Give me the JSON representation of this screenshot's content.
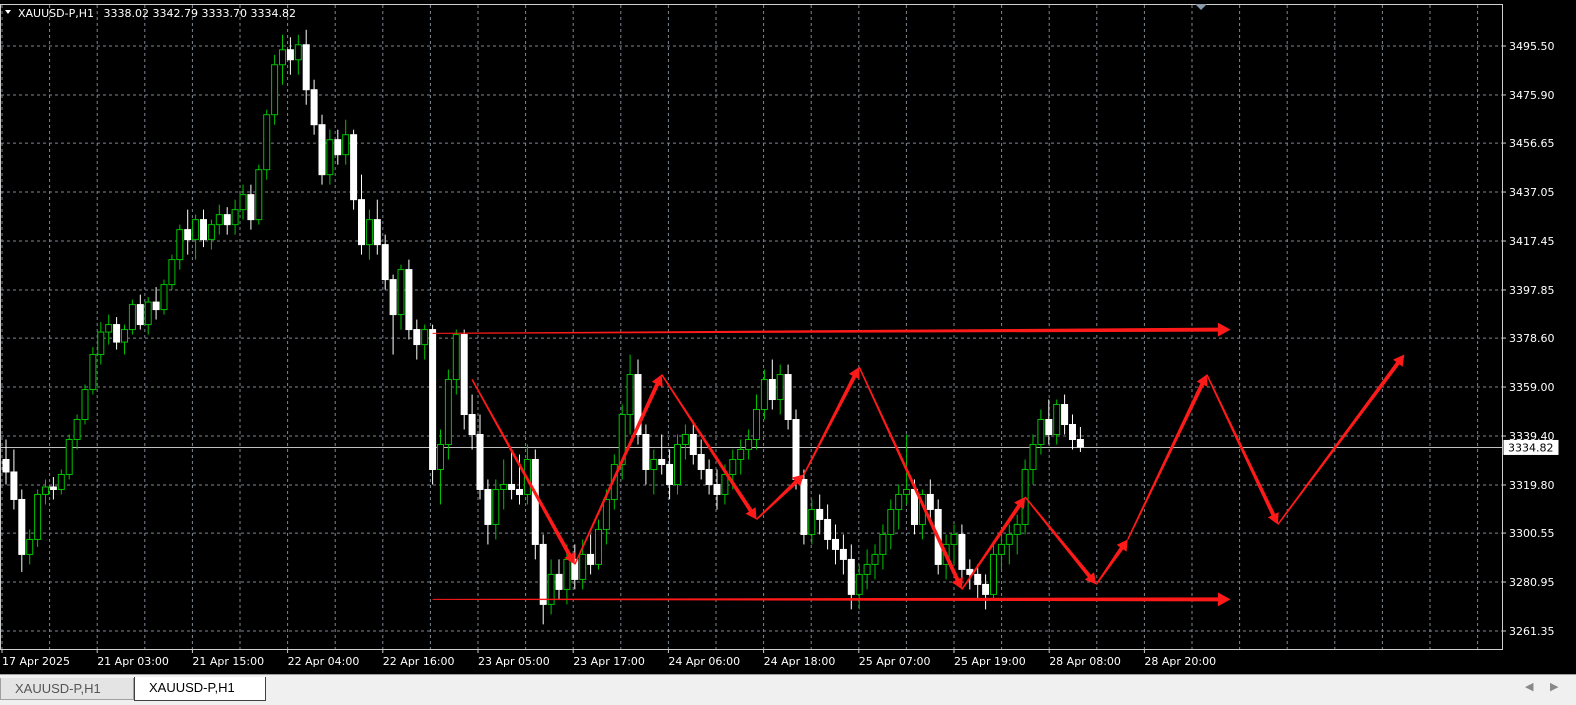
{
  "header": {
    "symbol": "XAUUSD-P,H1",
    "ohlc": "3338.02 3342.79 3333.70 3334.82"
  },
  "tabs": [
    {
      "label": "XAUUSD-P,H1",
      "active": false
    },
    {
      "label": "XAUUSD-P,H1",
      "active": true
    }
  ],
  "colors": {
    "background": "#000000",
    "grid": "#7f8792",
    "bull_candle": "#00c000",
    "bear_candle": "#ffffff",
    "current_price_line": "#c0c0c0",
    "annotation": "#ff1a1a"
  },
  "chart_data": {
    "type": "candlestick",
    "current_price": 3334.82,
    "ylim": [
      3252,
      3507
    ],
    "y_ticks": [
      "3495.50",
      "3475.90",
      "3456.65",
      "3437.05",
      "3417.45",
      "3397.85",
      "3378.60",
      "3359.00",
      "3339.40",
      "3319.80",
      "3300.55",
      "3280.95",
      "3261.35"
    ],
    "x_ticks": [
      "17 Apr 2025",
      "21 Apr 03:00",
      "21 Apr 15:00",
      "22 Apr 04:00",
      "22 Apr 16:00",
      "23 Apr 05:00",
      "23 Apr 17:00",
      "24 Apr 06:00",
      "24 Apr 18:00",
      "25 Apr 07:00",
      "25 Apr 19:00",
      "28 Apr 08:00",
      "28 Apr 20:00"
    ],
    "bars_per_tick": 12,
    "grid": true,
    "candles": [
      [
        3330,
        3338,
        3320,
        3325
      ],
      [
        3325,
        3334,
        3310,
        3314
      ],
      [
        3314,
        3318,
        3285,
        3292
      ],
      [
        3292,
        3302,
        3288,
        3298
      ],
      [
        3298,
        3318,
        3295,
        3316
      ],
      [
        3316,
        3322,
        3312,
        3319
      ],
      [
        3319,
        3323,
        3314,
        3318
      ],
      [
        3318,
        3326,
        3316,
        3324
      ],
      [
        3324,
        3340,
        3322,
        3338
      ],
      [
        3338,
        3348,
        3334,
        3346
      ],
      [
        3346,
        3360,
        3344,
        3358
      ],
      [
        3358,
        3375,
        3356,
        3372
      ],
      [
        3372,
        3385,
        3368,
        3381
      ],
      [
        3381,
        3388,
        3376,
        3384
      ],
      [
        3384,
        3387,
        3374,
        3377
      ],
      [
        3377,
        3384,
        3372,
        3382
      ],
      [
        3382,
        3394,
        3380,
        3392
      ],
      [
        3392,
        3396,
        3382,
        3384
      ],
      [
        3384,
        3395,
        3380,
        3393
      ],
      [
        3393,
        3399,
        3386,
        3390
      ],
      [
        3390,
        3402,
        3388,
        3400
      ],
      [
        3400,
        3412,
        3398,
        3410
      ],
      [
        3410,
        3424,
        3406,
        3422
      ],
      [
        3422,
        3430,
        3412,
        3418
      ],
      [
        3418,
        3428,
        3410,
        3426
      ],
      [
        3426,
        3430,
        3415,
        3418
      ],
      [
        3418,
        3426,
        3414,
        3424
      ],
      [
        3424,
        3432,
        3420,
        3428
      ],
      [
        3428,
        3431,
        3420,
        3424
      ],
      [
        3424,
        3434,
        3420,
        3430
      ],
      [
        3430,
        3440,
        3426,
        3436
      ],
      [
        3436,
        3440,
        3422,
        3426
      ],
      [
        3426,
        3448,
        3424,
        3446
      ],
      [
        3446,
        3470,
        3442,
        3468
      ],
      [
        3468,
        3492,
        3464,
        3488
      ],
      [
        3488,
        3500,
        3480,
        3494
      ],
      [
        3494,
        3499,
        3484,
        3490
      ],
      [
        3490,
        3500,
        3484,
        3496
      ],
      [
        3496,
        3502,
        3472,
        3478
      ],
      [
        3478,
        3482,
        3460,
        3464
      ],
      [
        3464,
        3468,
        3440,
        3444
      ],
      [
        3444,
        3462,
        3440,
        3458
      ],
      [
        3458,
        3462,
        3448,
        3452
      ],
      [
        3452,
        3466,
        3448,
        3460
      ],
      [
        3460,
        3462,
        3430,
        3434
      ],
      [
        3434,
        3444,
        3412,
        3416
      ],
      [
        3416,
        3430,
        3410,
        3426
      ],
      [
        3426,
        3434,
        3412,
        3416
      ],
      [
        3416,
        3420,
        3398,
        3402
      ],
      [
        3402,
        3404,
        3372,
        3388
      ],
      [
        3388,
        3408,
        3382,
        3406
      ],
      [
        3406,
        3410,
        3378,
        3382
      ],
      [
        3382,
        3386,
        3370,
        3376
      ],
      [
        3376,
        3384,
        3370,
        3382
      ],
      [
        3382,
        3384,
        3320,
        3326
      ],
      [
        3326,
        3342,
        3312,
        3336
      ],
      [
        3336,
        3366,
        3330,
        3362
      ],
      [
        3362,
        3382,
        3356,
        3380
      ],
      [
        3380,
        3382,
        3342,
        3348
      ],
      [
        3348,
        3356,
        3334,
        3340
      ],
      [
        3340,
        3348,
        3314,
        3318
      ],
      [
        3318,
        3322,
        3296,
        3304
      ],
      [
        3304,
        3322,
        3298,
        3318
      ],
      [
        3318,
        3330,
        3310,
        3320
      ],
      [
        3320,
        3334,
        3314,
        3318
      ],
      [
        3318,
        3332,
        3312,
        3316
      ],
      [
        3316,
        3336,
        3312,
        3330
      ],
      [
        3330,
        3334,
        3290,
        3296
      ],
      [
        3296,
        3300,
        3264,
        3272
      ],
      [
        3272,
        3290,
        3268,
        3284
      ],
      [
        3284,
        3290,
        3274,
        3278
      ],
      [
        3278,
        3296,
        3272,
        3290
      ],
      [
        3290,
        3296,
        3278,
        3282
      ],
      [
        3282,
        3298,
        3278,
        3292
      ],
      [
        3292,
        3300,
        3284,
        3288
      ],
      [
        3288,
        3306,
        3286,
        3302
      ],
      [
        3302,
        3318,
        3296,
        3314
      ],
      [
        3314,
        3332,
        3310,
        3328
      ],
      [
        3328,
        3352,
        3322,
        3348
      ],
      [
        3348,
        3372,
        3340,
        3364
      ],
      [
        3364,
        3370,
        3336,
        3340
      ],
      [
        3340,
        3344,
        3320,
        3326
      ],
      [
        3326,
        3334,
        3316,
        3330
      ],
      [
        3330,
        3340,
        3324,
        3328
      ],
      [
        3328,
        3334,
        3314,
        3320
      ],
      [
        3320,
        3340,
        3316,
        3336
      ],
      [
        3336,
        3344,
        3330,
        3340
      ],
      [
        3340,
        3344,
        3328,
        3332
      ],
      [
        3332,
        3338,
        3322,
        3326
      ],
      [
        3326,
        3330,
        3316,
        3320
      ],
      [
        3320,
        3326,
        3310,
        3316
      ],
      [
        3316,
        3328,
        3312,
        3324
      ],
      [
        3324,
        3334,
        3318,
        3330
      ],
      [
        3330,
        3338,
        3324,
        3334
      ],
      [
        3334,
        3342,
        3330,
        3338
      ],
      [
        3338,
        3356,
        3334,
        3350
      ],
      [
        3350,
        3366,
        3346,
        3362
      ],
      [
        3362,
        3370,
        3350,
        3354
      ],
      [
        3354,
        3368,
        3348,
        3364
      ],
      [
        3364,
        3368,
        3342,
        3346
      ],
      [
        3346,
        3350,
        3318,
        3322
      ],
      [
        3322,
        3326,
        3296,
        3300
      ],
      [
        3300,
        3314,
        3296,
        3310
      ],
      [
        3310,
        3316,
        3300,
        3306
      ],
      [
        3306,
        3312,
        3294,
        3298
      ],
      [
        3298,
        3304,
        3288,
        3294
      ],
      [
        3294,
        3300,
        3284,
        3290
      ],
      [
        3290,
        3296,
        3270,
        3276
      ],
      [
        3276,
        3288,
        3270,
        3284
      ],
      [
        3284,
        3294,
        3278,
        3288
      ],
      [
        3288,
        3296,
        3282,
        3292
      ],
      [
        3292,
        3304,
        3286,
        3300
      ],
      [
        3300,
        3314,
        3294,
        3310
      ],
      [
        3310,
        3320,
        3302,
        3316
      ],
      [
        3316,
        3340,
        3312,
        3318
      ],
      [
        3318,
        3322,
        3300,
        3304
      ],
      [
        3304,
        3318,
        3298,
        3316
      ],
      [
        3316,
        3322,
        3306,
        3310
      ],
      [
        3310,
        3314,
        3284,
        3288
      ],
      [
        3288,
        3300,
        3282,
        3296
      ],
      [
        3296,
        3304,
        3288,
        3300
      ],
      [
        3300,
        3304,
        3282,
        3286
      ],
      [
        3286,
        3290,
        3278,
        3284
      ],
      [
        3284,
        3288,
        3274,
        3280
      ],
      [
        3280,
        3284,
        3270,
        3276
      ],
      [
        3276,
        3296,
        3274,
        3292
      ],
      [
        3292,
        3300,
        3286,
        3296
      ],
      [
        3296,
        3304,
        3288,
        3300
      ],
      [
        3300,
        3308,
        3292,
        3304
      ],
      [
        3304,
        3330,
        3300,
        3326
      ],
      [
        3326,
        3340,
        3320,
        3336
      ],
      [
        3336,
        3350,
        3332,
        3346
      ],
      [
        3346,
        3354,
        3336,
        3340
      ],
      [
        3340,
        3354,
        3336,
        3352
      ],
      [
        3352,
        3356,
        3340,
        3344
      ],
      [
        3344,
        3348,
        3334,
        3338
      ],
      [
        3338,
        3343,
        3333,
        3335
      ]
    ],
    "annotations": {
      "horizontal_arrows": [
        {
          "from": [
            54,
            3380.5
          ],
          "to": [
            155,
            3382
          ]
        },
        {
          "from": [
            54,
            3274
          ],
          "to": [
            155,
            3274
          ]
        }
      ],
      "zigzag": [
        [
          59,
          3362
        ],
        [
          72,
          3288
        ],
        [
          83,
          3364
        ],
        [
          95,
          3306
        ],
        [
          101,
          3324
        ],
        [
          108,
          3367
        ],
        [
          121,
          3278
        ],
        [
          129,
          3315
        ],
        [
          138,
          3280
        ],
        [
          142,
          3298
        ],
        [
          152,
          3364
        ]
      ],
      "projection": [
        [
          152,
          3364
        ],
        [
          161,
          3304
        ],
        [
          177,
          3372
        ]
      ]
    }
  }
}
